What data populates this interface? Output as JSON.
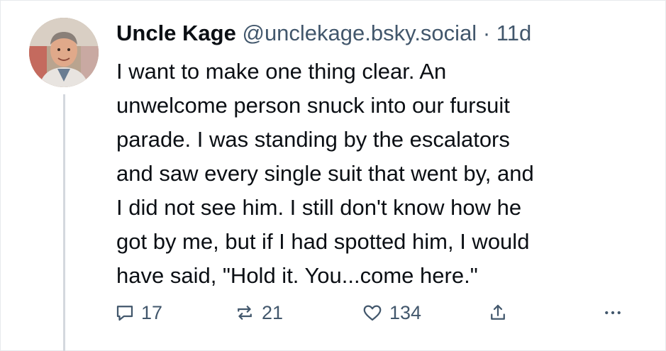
{
  "post": {
    "author": {
      "display_name": "Uncle Kage",
      "handle": "@unclekage.bsky.social",
      "separator": "·",
      "time_ago": "11d",
      "avatar": "avatar-photo"
    },
    "lines": [
      "I want to make one thing clear. An",
      "unwelcome person snuck into our fursuit",
      "parade. I was standing by the escalators",
      "and saw every single suit that went by, and",
      "I did not see him. I still don't know how he",
      "got by me, but if I had spotted him, I would",
      "have said, \"Hold it. You...come here.\""
    ],
    "actions": {
      "reply": {
        "icon": "reply-icon",
        "count": "17"
      },
      "repost": {
        "icon": "repost-icon",
        "count": "21"
      },
      "like": {
        "icon": "heart-icon",
        "count": "134"
      },
      "share": {
        "icon": "share-icon"
      },
      "more": {
        "icon": "more-icon"
      }
    }
  },
  "colors": {
    "text": "#0b0f14",
    "muted": "#42576c",
    "thread_line": "#d4d8de",
    "border": "#e7e9ec"
  }
}
